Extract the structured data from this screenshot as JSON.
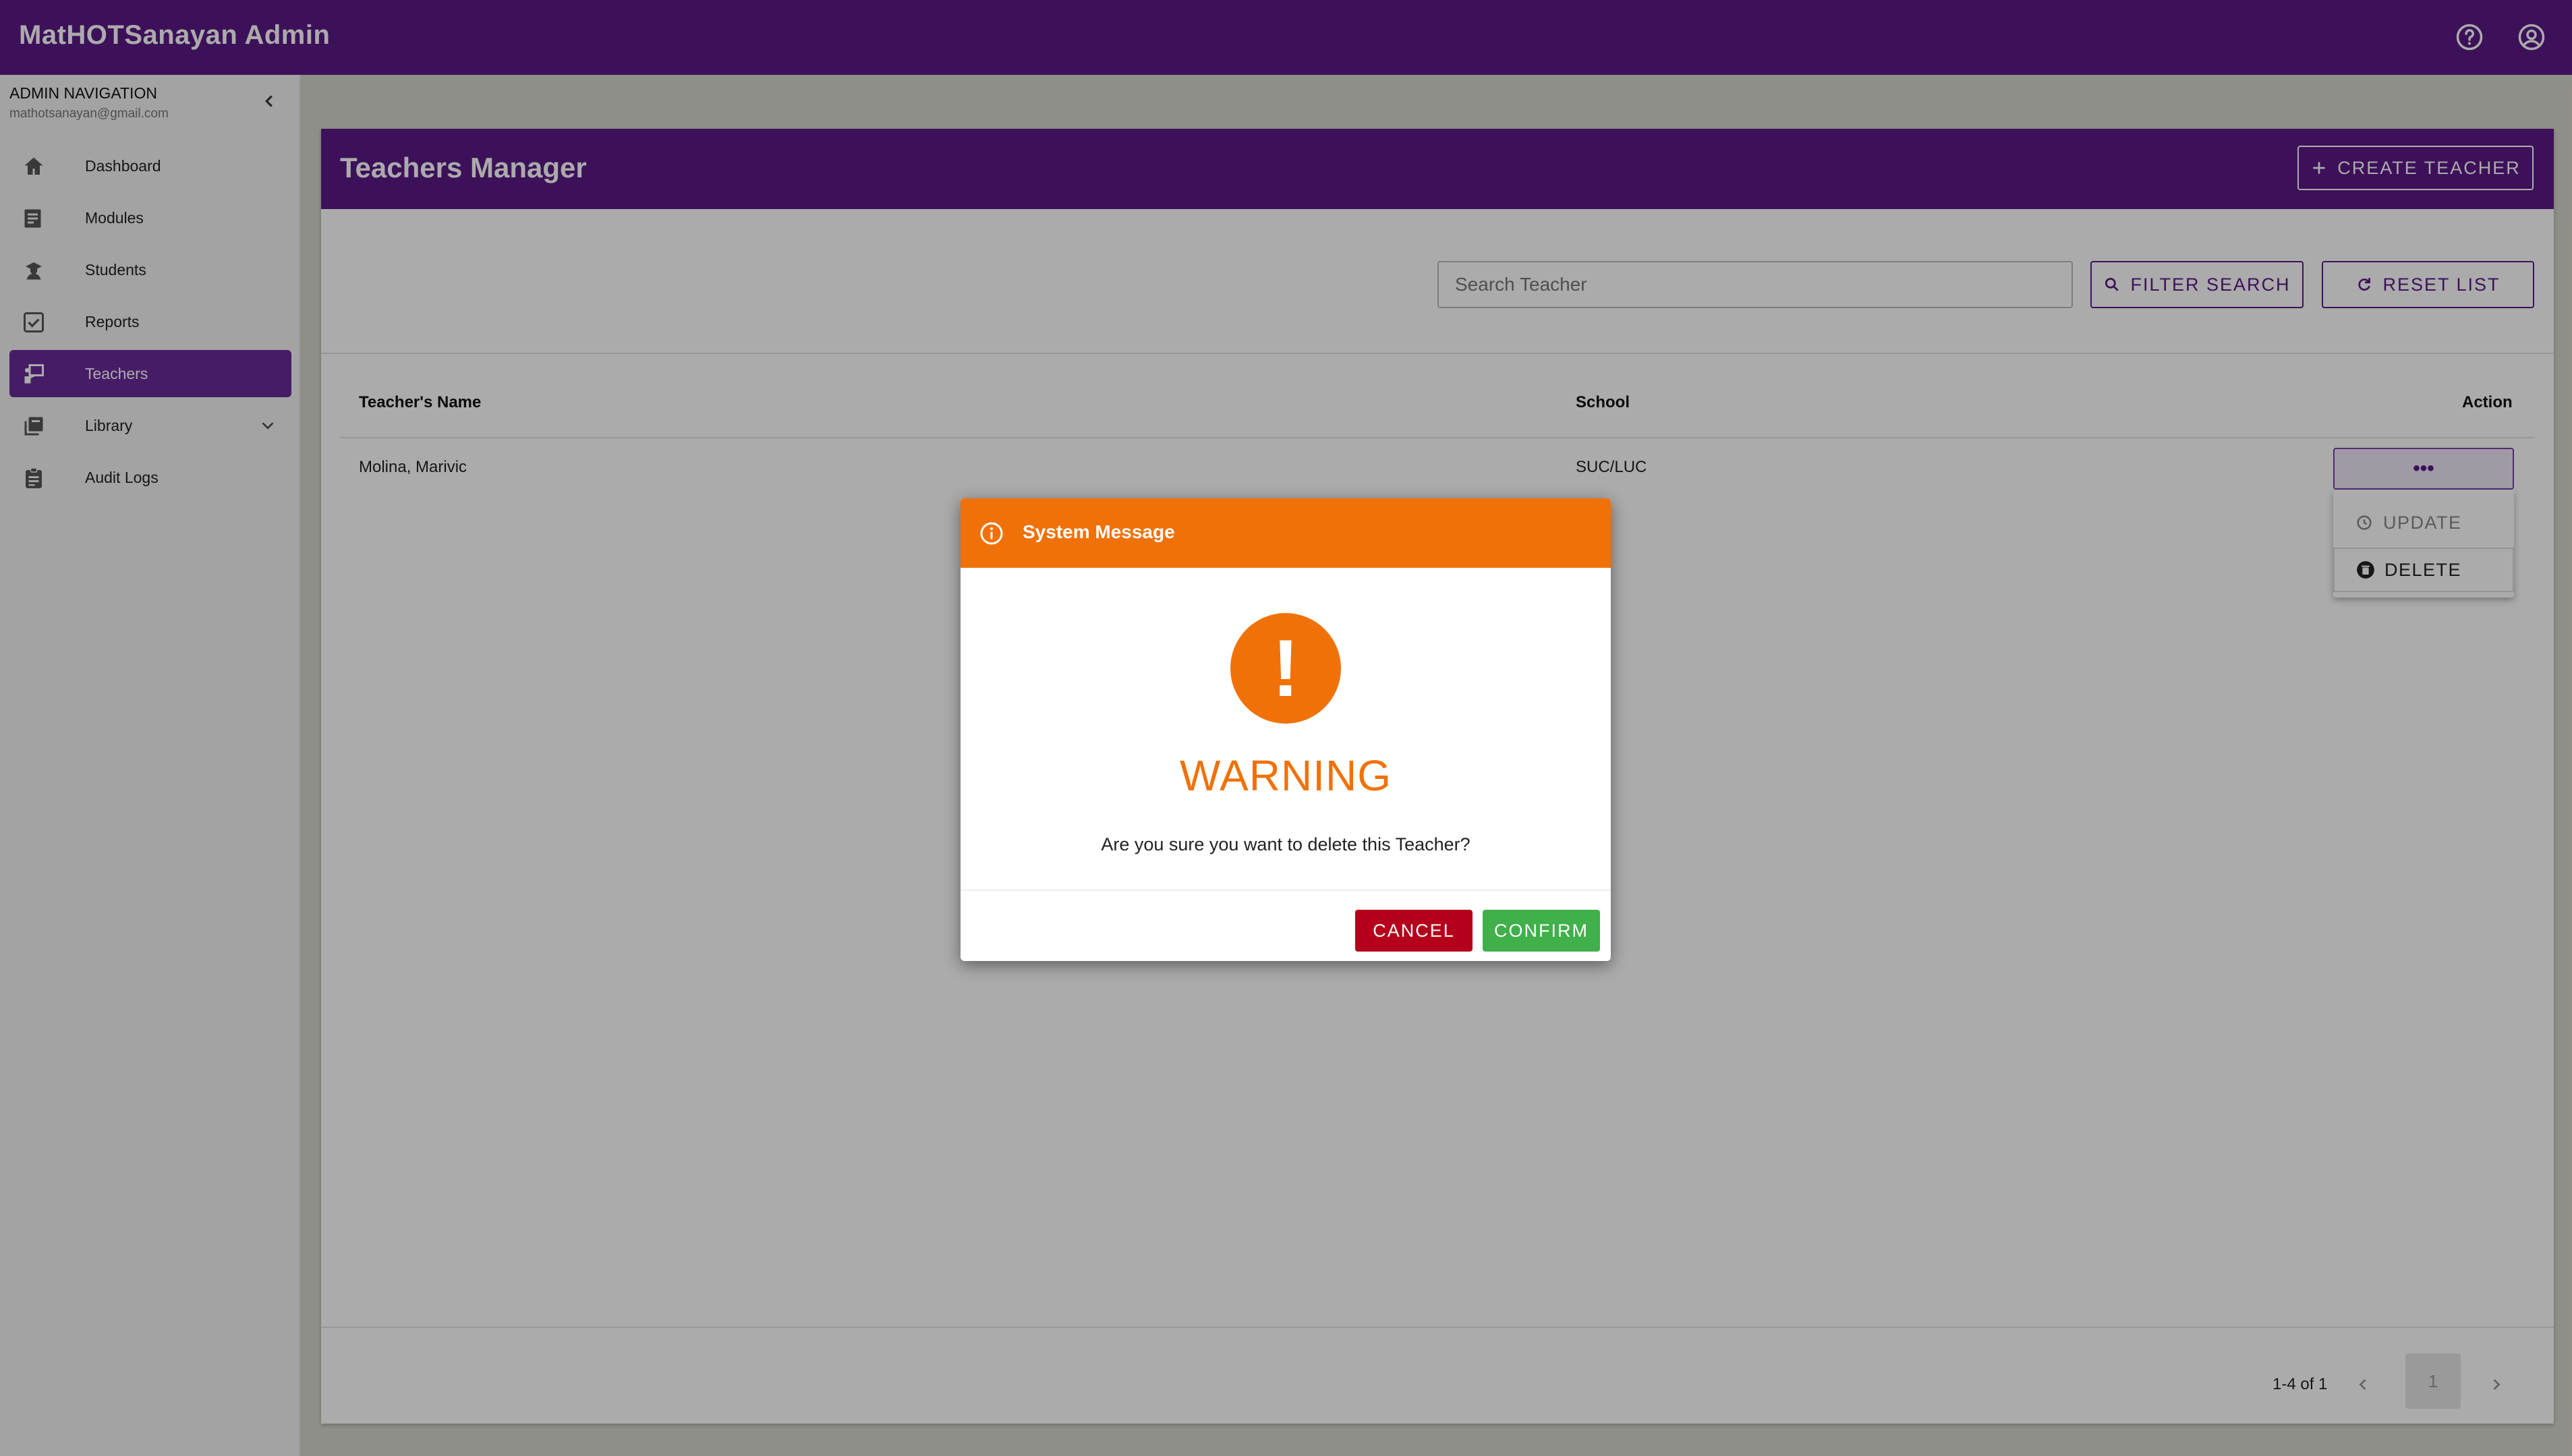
{
  "app": {
    "title": "MatHOTSanayan Admin"
  },
  "topbar": {
    "icons": [
      "help-icon",
      "account-icon"
    ]
  },
  "sidebar": {
    "title": "ADMIN NAVIGATION",
    "email": "mathotsanayan@gmail.com",
    "items": [
      {
        "label": "Dashboard",
        "icon": "home-icon"
      },
      {
        "label": "Modules",
        "icon": "modules-icon"
      },
      {
        "label": "Students",
        "icon": "student-icon"
      },
      {
        "label": "Reports",
        "icon": "reports-icon"
      },
      {
        "label": "Teachers",
        "icon": "teacher-icon",
        "active": true
      },
      {
        "label": "Library",
        "icon": "library-icon",
        "expandable": true
      },
      {
        "label": "Audit Logs",
        "icon": "clipboard-icon"
      }
    ]
  },
  "manager": {
    "title": "Teachers Manager",
    "create_label": "CREATE TEACHER",
    "search_placeholder": "Search Teacher",
    "filter_label": "FILTER SEARCH",
    "reset_label": "RESET LIST"
  },
  "table": {
    "headers": {
      "name": "Teacher's Name",
      "school": "School",
      "action": "Action"
    },
    "rows": [
      {
        "name": "Molina, Marivic",
        "school": "SUC/LUC",
        "action": "•••"
      }
    ]
  },
  "action_menu": {
    "update_label": "UPDATE",
    "delete_label": "DELETE"
  },
  "pagination": {
    "range": "1-4 of 1",
    "page": "1"
  },
  "dialog": {
    "title": "System Message",
    "icon_glyph": "!",
    "heading": "WARNING",
    "message": "Are you sure you want to delete this Teacher?",
    "cancel_label": "CANCEL",
    "confirm_label": "CONFIRM"
  },
  "colors": {
    "brand": "#5b1a86",
    "warning": "#f07108",
    "cancel": "#b4001b",
    "confirm": "#3fb04a"
  }
}
